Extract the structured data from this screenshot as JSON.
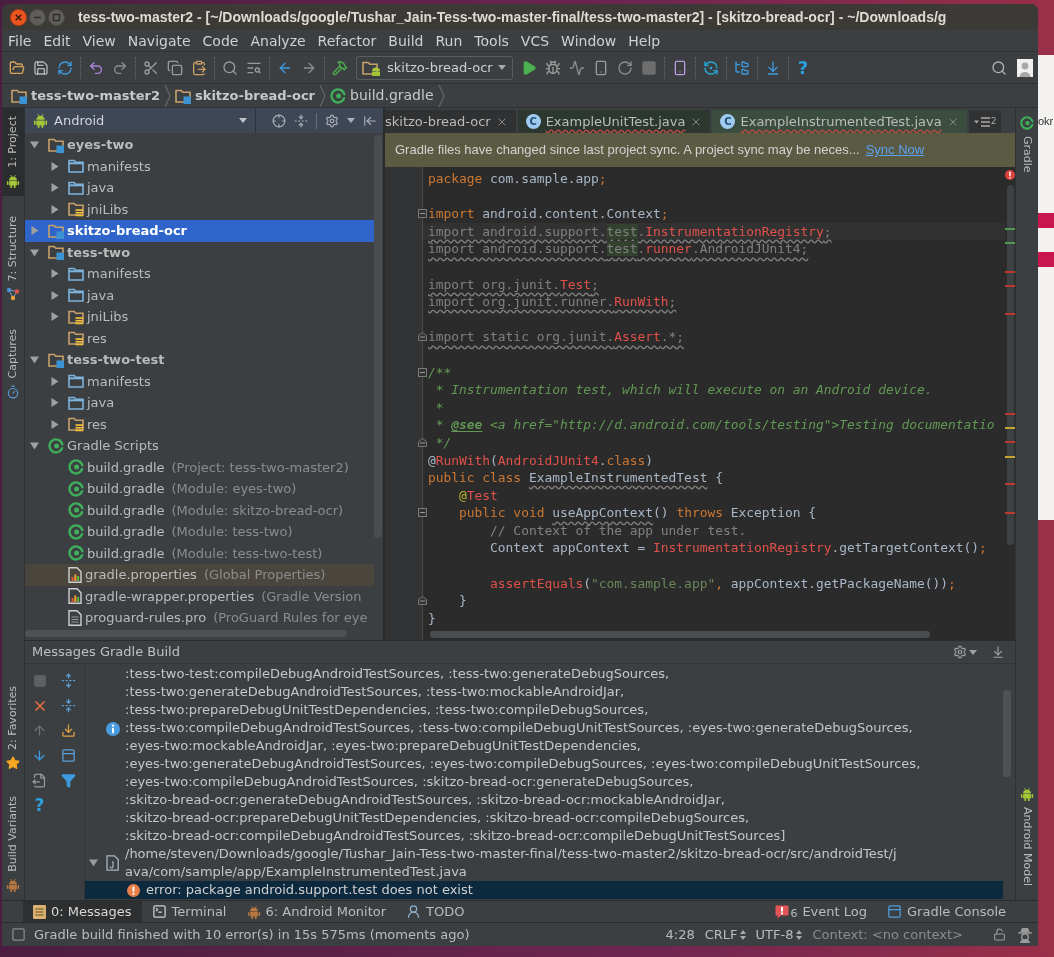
{
  "window": {
    "title": "tess-two-master2 - [~/Downloads/google/Tushar_Jain-Tess-two-master-final/tess-two-master2] - [skitzo-bread-ocr] - ~/Downloads/g"
  },
  "menu": [
    "File",
    "Edit",
    "View",
    "Navigate",
    "Code",
    "Analyze",
    "Refactor",
    "Build",
    "Run",
    "Tools",
    "VCS",
    "Window",
    "Help"
  ],
  "toolbar": {
    "run_config": "skitzo-bread-ocr",
    "help_glyph": "?"
  },
  "breadcrumbs": [
    {
      "label": "tess-two-master2",
      "kind": "module"
    },
    {
      "label": "skitzo-bread-ocr",
      "kind": "module"
    },
    {
      "label": "build.gradle",
      "kind": "gradle"
    }
  ],
  "left_strip": [
    {
      "label": "1: Project",
      "kind": "android",
      "selected": true
    },
    {
      "label": "7: Structure",
      "kind": "structure",
      "selected": false
    },
    {
      "label": "Captures",
      "kind": "captures",
      "selected": false
    }
  ],
  "left_strip_bottom": [
    {
      "label": "2: Favorites",
      "kind": "star",
      "selected": false
    },
    {
      "label": "Build Variants",
      "kind": "android",
      "selected": false
    }
  ],
  "project": {
    "view": "Android",
    "tree": [
      {
        "name": "eyes-two",
        "kind": "module",
        "expanded": true,
        "selected": false,
        "highlighted": false,
        "children": [
          {
            "name": "manifests",
            "kind": "folder",
            "expanded": false,
            "selected": false,
            "highlighted": false
          },
          {
            "name": "java",
            "kind": "folder",
            "expanded": false,
            "selected": false,
            "highlighted": false
          },
          {
            "name": "jniLibs",
            "kind": "resource_folder",
            "expanded": false,
            "selected": false,
            "highlighted": false
          }
        ]
      },
      {
        "name": "skitzo-bread-ocr",
        "kind": "module",
        "expanded": false,
        "selected": true,
        "highlighted": false
      },
      {
        "name": "tess-two",
        "kind": "module",
        "expanded": true,
        "selected": false,
        "highlighted": false,
        "children": [
          {
            "name": "manifests",
            "kind": "folder",
            "expanded": false,
            "selected": false,
            "highlighted": false
          },
          {
            "name": "java",
            "kind": "folder",
            "expanded": false,
            "selected": false,
            "highlighted": false
          },
          {
            "name": "jniLibs",
            "kind": "resource_folder",
            "expanded": false,
            "selected": false,
            "highlighted": false
          },
          {
            "name": "res",
            "kind": "resource_folder",
            "selected": false,
            "highlighted": false
          }
        ]
      },
      {
        "name": "tess-two-test",
        "kind": "module",
        "expanded": true,
        "selected": false,
        "highlighted": false,
        "children": [
          {
            "name": "manifests",
            "kind": "folder",
            "expanded": false,
            "selected": false,
            "highlighted": false
          },
          {
            "name": "java",
            "kind": "folder",
            "expanded": false,
            "selected": false,
            "highlighted": false
          },
          {
            "name": "res",
            "kind": "resource_folder",
            "expanded": false,
            "selected": false,
            "highlighted": false
          }
        ]
      },
      {
        "name": "Gradle Scripts",
        "kind": "gradle_group",
        "expanded": true,
        "selected": false,
        "highlighted": false,
        "children": [
          {
            "name": "build.gradle",
            "detail": "(Project: tess-two-master2)",
            "kind": "gradle_file",
            "selected": false,
            "highlighted": false
          },
          {
            "name": "build.gradle",
            "detail": "(Module: eyes-two)",
            "kind": "gradle_file",
            "selected": false,
            "highlighted": false
          },
          {
            "name": "build.gradle",
            "detail": "(Module: skitzo-bread-ocr)",
            "kind": "gradle_file",
            "selected": false,
            "highlighted": false
          },
          {
            "name": "build.gradle",
            "detail": "(Module: tess-two)",
            "kind": "gradle_file",
            "selected": false,
            "highlighted": false
          },
          {
            "name": "build.gradle",
            "detail": "(Module: tess-two-test)",
            "kind": "gradle_file",
            "selected": false,
            "highlighted": false
          },
          {
            "name": "gradle.properties",
            "detail": "(Global Properties)",
            "kind": "properties_file",
            "selected": false,
            "highlighted": true
          },
          {
            "name": "gradle-wrapper.properties",
            "detail": "(Gradle Version",
            "kind": "properties_file",
            "selected": false,
            "highlighted": false
          },
          {
            "name": "proguard-rules.pro",
            "detail": "(ProGuard Rules for eye",
            "kind": "text_file",
            "selected": false,
            "highlighted": false
          }
        ]
      }
    ]
  },
  "editor": {
    "tabs": [
      {
        "label": "skitzo-bread-ocr",
        "kind": "plain",
        "selected": false,
        "errors": false
      },
      {
        "label": "ExampleUnitTest.java",
        "kind": "test_class",
        "badge": "C",
        "selected": false,
        "errors": true
      },
      {
        "label": "ExampleInstrumentedTest.java",
        "kind": "test_class",
        "badge": "C",
        "selected": true,
        "errors": true
      }
    ],
    "overflow_count": "2",
    "notification": {
      "text": "Gradle files have changed since last project sync. A project sync may be neces...",
      "link": "Sync Now"
    },
    "lines": [
      {
        "kind": "plain",
        "current": false,
        "tokens": [
          {
            "text": "package",
            "kind": "keyword"
          },
          {
            "text": " com.sample.app",
            "kind": "plain"
          },
          {
            "text": ";",
            "kind": "keyword"
          }
        ]
      },
      {
        "kind": "plain",
        "current": false
      },
      {
        "kind": "fold_start",
        "current": false,
        "tokens": [
          {
            "text": "import",
            "kind": "keyword"
          },
          {
            "text": " android.content.Context",
            "kind": "plain"
          },
          {
            "text": ";",
            "kind": "keyword"
          }
        ]
      },
      {
        "kind": "plain",
        "current": true,
        "tokens": [
          {
            "text": "import android.support.",
            "kind": "unused"
          },
          {
            "text": "test",
            "kind": "unused_match"
          },
          {
            "text": ".",
            "kind": "unused"
          },
          {
            "text": "InstrumentationRegistry",
            "kind": "unused_error"
          },
          {
            "text": ";",
            "kind": "unused"
          }
        ]
      },
      {
        "kind": "plain",
        "current": false,
        "tokens": [
          {
            "text": "import android.support.",
            "kind": "unused"
          },
          {
            "text": "test",
            "kind": "unused_match"
          },
          {
            "text": ".",
            "kind": "unused"
          },
          {
            "text": "runner",
            "kind": "unused_error"
          },
          {
            "text": ".AndroidJUnit4;",
            "kind": "unused"
          }
        ]
      },
      {
        "kind": "plain",
        "current": false
      },
      {
        "kind": "plain",
        "current": false,
        "tokens": [
          {
            "text": "import org.junit.",
            "kind": "unused"
          },
          {
            "text": "Test",
            "kind": "unused_error"
          },
          {
            "text": ";",
            "kind": "unused"
          }
        ]
      },
      {
        "kind": "plain",
        "current": false,
        "tokens": [
          {
            "text": "import org.junit.runner.",
            "kind": "unused"
          },
          {
            "text": "RunWith",
            "kind": "unused_error"
          },
          {
            "text": ";",
            "kind": "unused"
          }
        ]
      },
      {
        "kind": "plain",
        "current": false
      },
      {
        "kind": "fold_end",
        "current": false,
        "tokens": [
          {
            "text": "import static org.junit.",
            "kind": "unused"
          },
          {
            "text": "Assert",
            "kind": "unused_error"
          },
          {
            "text": ".*;",
            "kind": "unused"
          }
        ]
      },
      {
        "kind": "plain",
        "current": false
      },
      {
        "kind": "fold_start",
        "current": false,
        "tokens": [
          {
            "text": "/**",
            "kind": "doc"
          }
        ]
      },
      {
        "kind": "plain",
        "current": false,
        "tokens": [
          {
            "text": " * Instrumentation test, which will execute on an Android device.",
            "kind": "doc"
          }
        ]
      },
      {
        "kind": "plain",
        "current": false,
        "tokens": [
          {
            "text": " *",
            "kind": "doc"
          }
        ]
      },
      {
        "kind": "plain",
        "current": false,
        "tokens": [
          {
            "text": " * ",
            "kind": "doc"
          },
          {
            "text": "@see",
            "kind": "doc_tag"
          },
          {
            "text": " <a href=\"http://d.android.com/tools/testing\">Testing documentatio",
            "kind": "doc"
          }
        ]
      },
      {
        "kind": "fold_end",
        "current": false,
        "tokens": [
          {
            "text": " */",
            "kind": "doc"
          }
        ]
      },
      {
        "kind": "plain",
        "current": false,
        "tokens": [
          {
            "text": "@",
            "kind": "plain"
          },
          {
            "text": "RunWith",
            "kind": "error"
          },
          {
            "text": "(",
            "kind": "plain"
          },
          {
            "text": "AndroidJUnit4",
            "kind": "error"
          },
          {
            "text": ".",
            "kind": "plain"
          },
          {
            "text": "class",
            "kind": "keyword"
          },
          {
            "text": ")",
            "kind": "plain"
          }
        ]
      },
      {
        "kind": "plain",
        "current": false,
        "tokens": [
          {
            "text": "public class ",
            "kind": "keyword"
          },
          {
            "text": "ExampleInstrumentedTest",
            "kind": "warning"
          },
          {
            "text": " {",
            "kind": "plain"
          }
        ]
      },
      {
        "kind": "plain",
        "current": false,
        "tokens": [
          {
            "text": "    @",
            "kind": "annotation"
          },
          {
            "text": "Test",
            "kind": "error"
          }
        ]
      },
      {
        "kind": "fold_start",
        "current": false,
        "tokens": [
          {
            "text": "    public void ",
            "kind": "keyword"
          },
          {
            "text": "useAppContext",
            "kind": "warning"
          },
          {
            "text": "() ",
            "kind": "plain"
          },
          {
            "text": "throws",
            "kind": "keyword"
          },
          {
            "text": " Exception {",
            "kind": "plain"
          }
        ]
      },
      {
        "kind": "plain",
        "current": false,
        "tokens": [
          {
            "text": "        // Context of the app under test.",
            "kind": "comment"
          }
        ]
      },
      {
        "kind": "plain",
        "current": false,
        "tokens": [
          {
            "text": "        Context appContext = ",
            "kind": "plain"
          },
          {
            "text": "InstrumentationRegistry",
            "kind": "error"
          },
          {
            "text": ".getTargetContext()",
            "kind": "plain"
          },
          {
            "text": ";",
            "kind": "keyword"
          }
        ]
      },
      {
        "kind": "plain",
        "current": false
      },
      {
        "kind": "plain",
        "current": false,
        "tokens": [
          {
            "text": "        assertEquals",
            "kind": "error"
          },
          {
            "text": "(",
            "kind": "plain"
          },
          {
            "text": "\"com.sample.app\"",
            "kind": "string"
          },
          {
            "text": ",",
            "kind": "keyword"
          },
          {
            "text": " appContext.getPackageName())",
            "kind": "plain"
          },
          {
            "text": ";",
            "kind": "keyword"
          }
        ]
      },
      {
        "kind": "fold_end",
        "current": false,
        "tokens": [
          {
            "text": "    }",
            "kind": "plain"
          }
        ]
      },
      {
        "kind": "plain",
        "current": false,
        "tokens": [
          {
            "text": "}",
            "kind": "plain"
          }
        ]
      }
    ]
  },
  "right_strip": [
    {
      "label": "Gradle",
      "kind": "gradle",
      "selected": false
    }
  ],
  "right_strip_bottom": [
    {
      "label": "Android Model",
      "kind": "android",
      "selected": false
    }
  ],
  "messages": {
    "title": "Messages Gradle Build",
    "help_glyph": "?",
    "items": [
      {
        "kind": "info",
        "selected": false,
        "lines": [
          ":tess-two-test:compileDebugAndroidTestSources, :tess-two:generateDebugSources,",
          ":tess-two:generateDebugAndroidTestSources, :tess-two:mockableAndroidJar,",
          ":tess-two:prepareDebugUnitTestDependencies, :tess-two:compileDebugSources,",
          ":tess-two:compileDebugAndroidTestSources, :tess-two:compileDebugUnitTestSources, :eyes-two:generateDebugSources,",
          ":eyes-two:mockableAndroidJar, :eyes-two:prepareDebugUnitTestDependencies,",
          ":eyes-two:generateDebugAndroidTestSources, :eyes-two:compileDebugSources, :eyes-two:compileDebugUnitTestSources,",
          ":eyes-two:compileDebugAndroidTestSources, :skitzo-bread-ocr:generateDebugSources,",
          ":skitzo-bread-ocr:generateDebugAndroidTestSources, :skitzo-bread-ocr:mockableAndroidJar,",
          ":skitzo-bread-ocr:prepareDebugUnitTestDependencies, :skitzo-bread-ocr:compileDebugSources,",
          ":skitzo-bread-ocr:compileDebugAndroidTestSources, :skitzo-bread-ocr:compileDebugUnitTestSources]"
        ]
      },
      {
        "kind": "file",
        "selected": false,
        "expanded": true,
        "lines": [
          "/home/steven/Downloads/google/Tushar_Jain-Tess-two-master-final/tess-two-master2/skitzo-bread-ocr/src/androidTest/j",
          "ava/com/sample/app/ExampleInstrumentedTest.java"
        ],
        "children": [
          {
            "kind": "error",
            "selected": true,
            "text": "error: package android.support.test does not exist"
          }
        ]
      }
    ]
  },
  "tool_tabs": [
    {
      "label": "0: Messages",
      "kind": "messages",
      "selected": true
    },
    {
      "label": "Terminal",
      "kind": "terminal",
      "selected": false
    },
    {
      "label": "6: Android Monitor",
      "kind": "android",
      "selected": false
    },
    {
      "label": "TODO",
      "kind": "todo",
      "selected": false
    }
  ],
  "tool_tabs_right": [
    {
      "label": "Event Log",
      "kind": "event_log",
      "count": "6",
      "selected": false
    },
    {
      "label": "Gradle Console",
      "kind": "console",
      "selected": false
    }
  ],
  "status_bar": {
    "message": "Gradle build finished with 10 error(s) in 15s 575ms (moments ago)",
    "position": "4:28",
    "line_separator": "CRLF",
    "encoding": "UTF-8",
    "context": "Context: <no context>"
  },
  "background_window": {
    "text": "okr"
  }
}
